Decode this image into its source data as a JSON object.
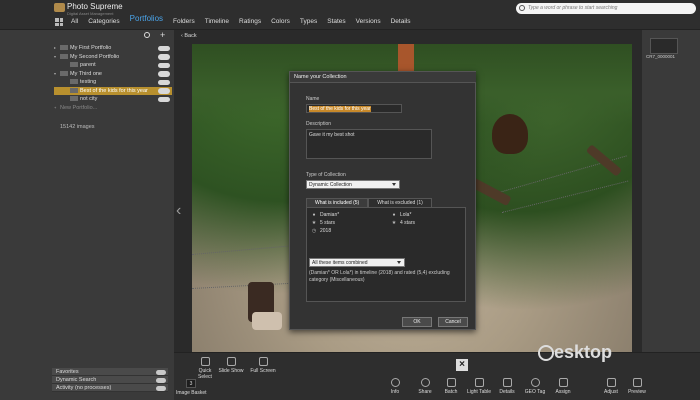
{
  "app": {
    "title": "Photo Supreme",
    "subtitle": "Digital Asset Management"
  },
  "nav": {
    "items": [
      "All",
      "Categories",
      "Portfolios",
      "Folders",
      "Timeline",
      "Ratings",
      "Colors",
      "Types",
      "States",
      "Versions",
      "Details"
    ],
    "active": "Portfolios"
  },
  "search": {
    "placeholder": "Type a word or phrase to start searching"
  },
  "leftpanel": {
    "tree": [
      {
        "label": "My First Portfolio",
        "level": 0
      },
      {
        "label": "My Second Portfolio",
        "level": 0
      },
      {
        "label": "parent",
        "level": 1
      },
      {
        "label": "My Third one",
        "level": 0
      },
      {
        "label": "testing",
        "level": 1
      },
      {
        "label": "Best of the kids for this year",
        "level": 1,
        "selected": true
      },
      {
        "label": "not city",
        "level": 1
      },
      {
        "label": "New Portfolio...",
        "level": 0
      }
    ],
    "count": "15142 images",
    "sections": [
      "Favorites",
      "Dynamic Search",
      "Activity (no processes)"
    ]
  },
  "main": {
    "back_label": "Back"
  },
  "dialog": {
    "title": "Name your Collection",
    "name_label": "Name",
    "name_value": "Best of the kids for this year",
    "description_label": "Description",
    "description_value": "Gave it my best shot",
    "type_label": "Type of Collection",
    "type_value": "Dynamic Collection",
    "tab_included": "What is included (5)",
    "tab_excluded": "What is excluded (1)",
    "criteria": [
      {
        "icon": "person-icon",
        "text": "Damian*"
      },
      {
        "icon": "person-icon",
        "text": "Lola*"
      },
      {
        "icon": "star-icon",
        "text": "5 stars"
      },
      {
        "icon": "star-icon",
        "text": "4 stars"
      },
      {
        "icon": "clock-icon",
        "text": "2018"
      }
    ],
    "combine_value": "All these items combined",
    "summary": "(Damian* OR Lola*) in timeline (2018) and rated (5,4) excluding category (Miscellaneous)",
    "ok_label": "OK",
    "cancel_label": "Cancel"
  },
  "rightstrip": {
    "label": "CR7_0000001"
  },
  "bottombar": {
    "left_items": [
      "Quick Select",
      "Slide Show",
      "Full Screen"
    ],
    "basket_count": "3",
    "basket_label": "Image Basket",
    "right_items": [
      "Info",
      "Share",
      "Batch",
      "Light Table",
      "Details",
      "GEO Tag",
      "Assign",
      "Adjust",
      "Preview"
    ]
  },
  "watermark": {
    "text": "esktop"
  }
}
